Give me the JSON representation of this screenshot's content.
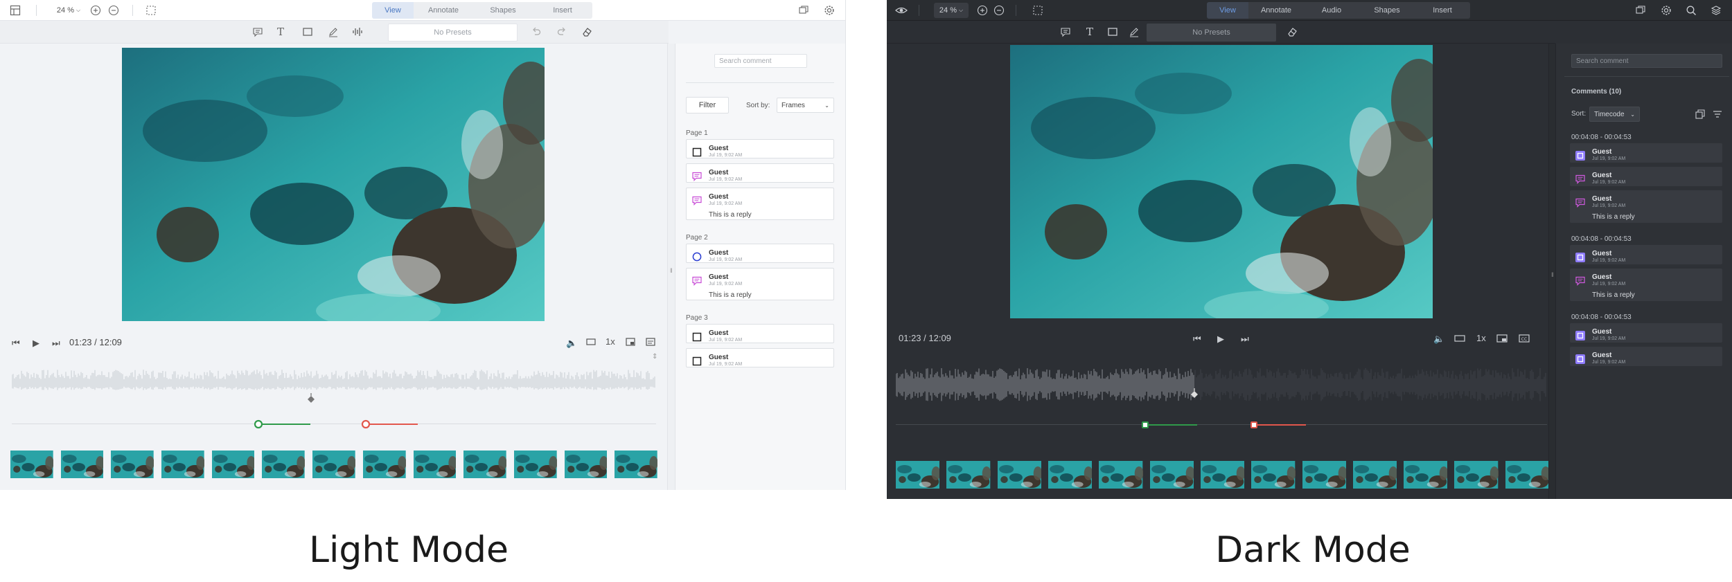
{
  "light": {
    "zoom": "24 %",
    "tabs": [
      "View",
      "Annotate",
      "Shapes",
      "Insert"
    ],
    "presets": "No Presets",
    "timecode": "01:23 / 12:09",
    "speed": "1x",
    "search_placeholder": "Search comment",
    "filter_label": "Filter",
    "sort_label": "Sort by:",
    "sort_value": "Frames",
    "groups": [
      {
        "title": "Page 1",
        "comments": [
          {
            "icon": "square-icon",
            "name": "Guest",
            "date": "Jul 19, 9:02 AM",
            "reply": ""
          },
          {
            "icon": "comment-icon",
            "name": "Guest",
            "date": "Jul 19, 9:02 AM",
            "reply": ""
          },
          {
            "icon": "comment-icon",
            "name": "Guest",
            "date": "Jul 19, 9:02 AM",
            "reply": "This is a reply"
          }
        ]
      },
      {
        "title": "Page 2",
        "comments": [
          {
            "icon": "circle-icon",
            "name": "Guest",
            "date": "Jul 19, 9:02 AM",
            "reply": ""
          },
          {
            "icon": "comment-icon",
            "name": "Guest",
            "date": "Jul 19, 9:02 AM",
            "reply": "This is a reply"
          }
        ]
      },
      {
        "title": "Page 3",
        "comments": [
          {
            "icon": "square-icon",
            "name": "Guest",
            "date": "Jul 19, 9:02 AM",
            "reply": ""
          },
          {
            "icon": "square-icon",
            "name": "Guest",
            "date": "Jul 19, 9:02 AM",
            "reply": ""
          }
        ]
      }
    ],
    "caption": "Light Mode"
  },
  "dark": {
    "zoom": "24 %",
    "tabs": [
      "View",
      "Annotate",
      "Audio",
      "Shapes",
      "Insert"
    ],
    "presets": "No Presets",
    "timecode": "01:23 / 12:09",
    "speed": "1x",
    "search_placeholder": "Search comment",
    "comments_count": "Comments (10)",
    "sort_label": "Sort:",
    "sort_value": "Timecode",
    "groups": [
      {
        "title": "00:04:08 - 00:04:53",
        "comments": [
          {
            "icon": "square-icon",
            "name": "Guest",
            "date": "Jul 19, 9:02 AM",
            "reply": ""
          },
          {
            "icon": "comment-icon",
            "name": "Guest",
            "date": "Jul 19, 9:02 AM",
            "reply": ""
          },
          {
            "icon": "comment-icon",
            "name": "Guest",
            "date": "Jul 19, 9:02 AM",
            "reply": "This is a reply"
          }
        ]
      },
      {
        "title": "00:04:08 - 00:04:53",
        "comments": [
          {
            "icon": "square-icon",
            "name": "Guest",
            "date": "Jul 19, 9:02 AM",
            "reply": ""
          },
          {
            "icon": "comment-icon",
            "name": "Guest",
            "date": "Jul 19, 9:02 AM",
            "reply": "This is a reply"
          }
        ]
      },
      {
        "title": "00:04:08 - 00:04:53",
        "comments": [
          {
            "icon": "square-icon",
            "name": "Guest",
            "date": "Jul 19, 9:02 AM",
            "reply": ""
          },
          {
            "icon": "square-icon",
            "name": "Guest",
            "date": "Jul 19, 9:02 AM",
            "reply": ""
          }
        ]
      }
    ],
    "caption": "Dark Mode"
  },
  "colors": {
    "accent_light": "#4a78c2",
    "accent_dark": "#6e9de6",
    "comment_light": "#c74ad6",
    "comment_dark": "#d05ae0",
    "square_dark": "#8f7cff",
    "circle_light": "#2d3fd1",
    "range_green": "#2f9a4a",
    "range_red": "#e2574c"
  }
}
